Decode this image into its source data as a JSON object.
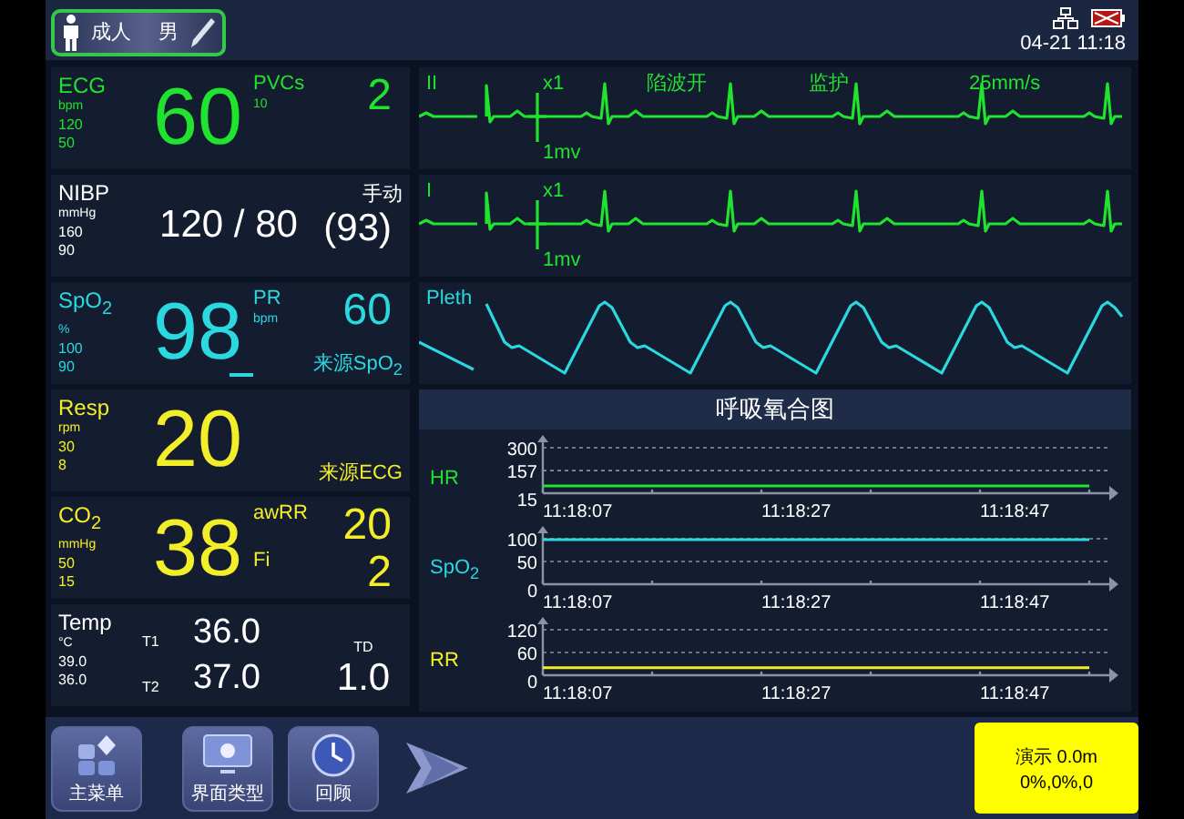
{
  "patient": {
    "category": "成人",
    "sex": "男"
  },
  "status": {
    "datetime": "04-21 11:18"
  },
  "panels": [
    {
      "kind": "vital",
      "label": "ECG",
      "unit": "bpm",
      "high": "120",
      "low": "50",
      "value": "60",
      "color": "#1fe32e",
      "side": [
        {
          "label": "PVCs",
          "sub": "10",
          "value": "2"
        }
      ]
    },
    {
      "kind": "nibp",
      "label": "NIBP",
      "unit": "mmHg",
      "high": "160",
      "low": "90",
      "value": "120 / 80",
      "color": "#ffffff",
      "mode": "手动",
      "mean": "(93)"
    },
    {
      "kind": "vital",
      "label": "SpO$_{2}$",
      "unit": "%",
      "high": "100",
      "low": "90",
      "value": "98",
      "color": "#2ad8e0",
      "side": [
        {
          "label": "PR",
          "sub": "bpm",
          "value": "60"
        }
      ],
      "note": "来源SpO$_{2}$",
      "pulse_bar": true
    },
    {
      "kind": "vital",
      "label": "Resp",
      "unit": "rpm",
      "high": "30",
      "low": "8",
      "value": "20",
      "color": "#f3ee2a",
      "note": "来源ECG"
    },
    {
      "kind": "vital",
      "label": "CO$_{2}$",
      "unit": "mmHg",
      "high": "50",
      "low": "15",
      "value": "38",
      "color": "#f3ee2a",
      "side": [
        {
          "label": "awRR",
          "value": "20"
        },
        {
          "label": "Fi",
          "value": "2"
        }
      ]
    },
    {
      "kind": "temp",
      "label": "Temp",
      "unit": "°C",
      "high": "39.0",
      "low": "36.0",
      "color": "#ffffff",
      "t1": {
        "label": "T1",
        "value": "36.0"
      },
      "t2": {
        "label": "T2",
        "value": "37.0"
      },
      "td": {
        "label": "TD",
        "value": "1.0"
      }
    }
  ],
  "waves": [
    {
      "kind": "ecg",
      "label": "II",
      "color": "#1fe32e",
      "gain": "x1",
      "scale": "1mv",
      "filter": "陷波开",
      "mode": "监护",
      "speed": "25mm/s"
    },
    {
      "kind": "ecg",
      "label": "I",
      "color": "#1fe32e",
      "gain": "x1",
      "scale": "1mv"
    },
    {
      "kind": "pleth",
      "label": "Pleth",
      "color": "#2ad8e0"
    }
  ],
  "trends": {
    "title": "呼吸氧合图",
    "charts": [
      {
        "chart_data": {
          "type": "line",
          "ylabel": "HR",
          "categories": [
            "11:18:07",
            null,
            "11:18:27",
            null,
            "11:18:47",
            null
          ],
          "ylim": [
            15,
            300
          ],
          "yticks": [
            15,
            157,
            300
          ],
          "series": [
            {
              "color": "#1fe32e",
              "values": [
                60,
                60,
                60,
                60,
                60,
                60
              ]
            }
          ]
        }
      },
      {
        "chart_data": {
          "type": "line",
          "ylabel": "SpO$_{2}$",
          "categories": [
            "11:18:07",
            null,
            "11:18:27",
            null,
            "11:18:47",
            null
          ],
          "ylim": [
            0,
            100
          ],
          "yticks": [
            0,
            50,
            100
          ],
          "series": [
            {
              "color": "#2ad8e0",
              "values": [
                98,
                98,
                98,
                98,
                98,
                98
              ]
            }
          ]
        }
      },
      {
        "chart_data": {
          "type": "line",
          "ylabel": "RR",
          "categories": [
            "11:18:07",
            null,
            "11:18:27",
            null,
            "11:18:47",
            null
          ],
          "ylim": [
            0,
            120
          ],
          "yticks": [
            0,
            60,
            120
          ],
          "series": [
            {
              "color": "#f3ee2a",
              "values": [
                20,
                20,
                20,
                20,
                20,
                20
              ]
            }
          ]
        }
      }
    ]
  },
  "buttons": [
    {
      "kind": "menu",
      "label": "主菜单"
    },
    {
      "kind": "display",
      "label": "界面类型"
    },
    {
      "kind": "clock",
      "label": "回顾"
    }
  ],
  "demo": {
    "line_1": "演示 0.0m",
    "line_2": "0%,0%,0"
  }
}
